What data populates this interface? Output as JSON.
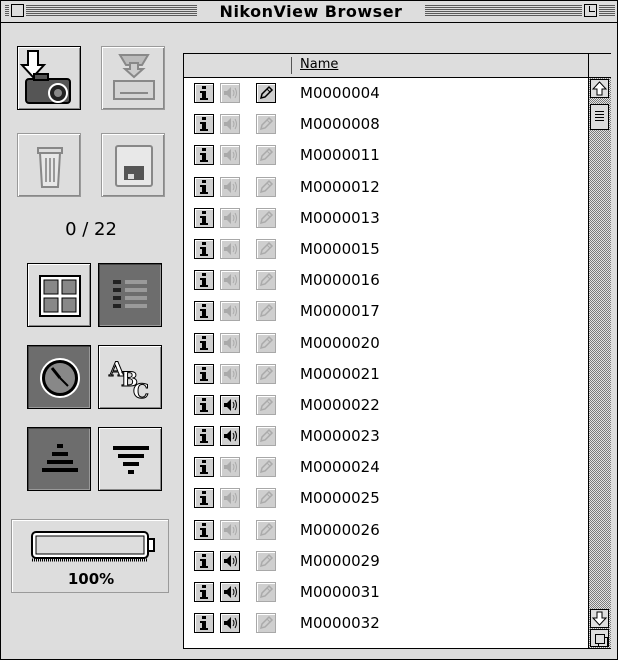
{
  "window": {
    "title": "NikonView Browser"
  },
  "toolbar": {
    "counter": "0 / 22",
    "battery_level": "100%"
  },
  "list": {
    "header": {
      "name_label": "Name"
    },
    "rows": [
      {
        "name": "M0000004",
        "has_sound": false,
        "pen_active": true
      },
      {
        "name": "M0000008",
        "has_sound": false,
        "pen_active": false
      },
      {
        "name": "M0000011",
        "has_sound": false,
        "pen_active": false
      },
      {
        "name": "M0000012",
        "has_sound": false,
        "pen_active": false
      },
      {
        "name": "M0000013",
        "has_sound": false,
        "pen_active": false
      },
      {
        "name": "M0000015",
        "has_sound": false,
        "pen_active": false
      },
      {
        "name": "M0000016",
        "has_sound": false,
        "pen_active": false
      },
      {
        "name": "M0000017",
        "has_sound": false,
        "pen_active": false
      },
      {
        "name": "M0000020",
        "has_sound": false,
        "pen_active": false
      },
      {
        "name": "M0000021",
        "has_sound": false,
        "pen_active": false
      },
      {
        "name": "M0000022",
        "has_sound": true,
        "pen_active": false
      },
      {
        "name": "M0000023",
        "has_sound": true,
        "pen_active": false
      },
      {
        "name": "M0000024",
        "has_sound": false,
        "pen_active": false
      },
      {
        "name": "M0000025",
        "has_sound": false,
        "pen_active": false
      },
      {
        "name": "M0000026",
        "has_sound": false,
        "pen_active": false
      },
      {
        "name": "M0000029",
        "has_sound": true,
        "pen_active": false
      },
      {
        "name": "M0000031",
        "has_sound": true,
        "pen_active": false
      },
      {
        "name": "M0000032",
        "has_sound": true,
        "pen_active": false
      }
    ]
  },
  "icons": {
    "download": "camera-download-icon",
    "print": "printer-icon",
    "trash": "trash-icon",
    "save": "floppy-disk-icon",
    "thumb_view": "thumbnail-view-icon",
    "list_view": "list-view-icon",
    "sort_date": "clock-icon",
    "sort_name": "abc-icon",
    "sort_asc": "sort-ascending-icon",
    "sort_desc": "sort-descending-icon",
    "battery": "battery-icon",
    "info": "info-icon",
    "sound": "speaker-icon",
    "pen": "pencil-icon"
  }
}
